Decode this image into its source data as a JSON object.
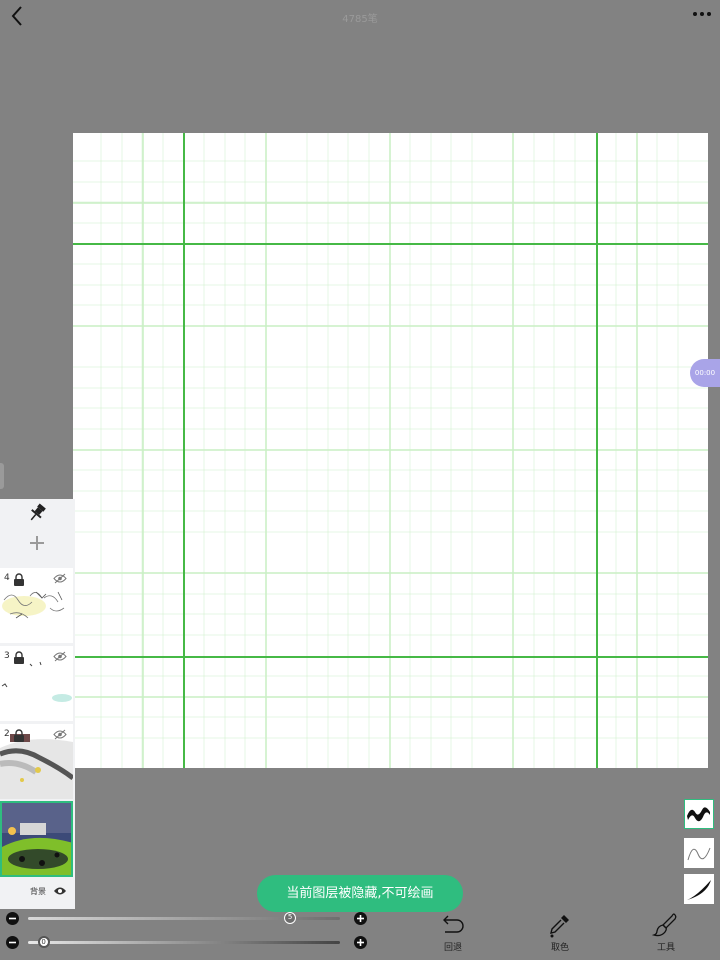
{
  "header": {
    "title": "4785笔"
  },
  "timer": {
    "text": "00:00"
  },
  "layers": {
    "items": [
      {
        "number": "4"
      },
      {
        "number": "3"
      },
      {
        "number": "2"
      }
    ],
    "background_label": "背景"
  },
  "toast": {
    "message": "当前图层被隐藏,不可绘画"
  },
  "sliders": {
    "size": {
      "knob_label": "5",
      "level": 0.84
    },
    "opacity": {
      "knob_label": "0",
      "level": 0.05
    }
  },
  "toolbar": {
    "undo_label": "回退",
    "eyedropper_label": "取色",
    "tools_label": "工具"
  },
  "colors": {
    "grid_major": "#46b946",
    "grid_minor": "#c9efc4",
    "toast": "#2fbd7f",
    "timer": "#a9a4e8"
  }
}
